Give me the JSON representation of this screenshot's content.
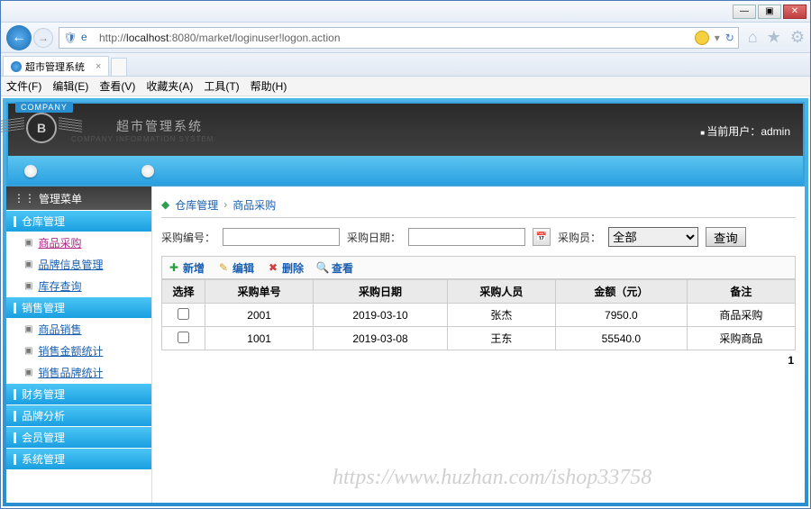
{
  "window": {
    "min": "—",
    "max": "▣",
    "close": "✕"
  },
  "browser": {
    "url_prefix": "http://",
    "url_host": "localhost",
    "url_rest": ":8080/market/loginuser!logon.action",
    "tab_title": "超市管理系统",
    "menu": [
      "文件(F)",
      "编辑(E)",
      "查看(V)",
      "收藏夹(A)",
      "工具(T)",
      "帮助(H)"
    ]
  },
  "app": {
    "company_tag": "COMPANY",
    "logo_letter": "B",
    "title": "超市管理系统",
    "subtitle": "COMPANY INFORMATION SYSTEM",
    "user_label": "当前用户：",
    "user_name": "admin"
  },
  "sidebar": {
    "title": "管理菜单",
    "groups": [
      {
        "label": "仓库管理",
        "items": [
          {
            "label": "商品采购",
            "active": true
          },
          {
            "label": "品牌信息管理"
          },
          {
            "label": "库存查询"
          }
        ]
      },
      {
        "label": "销售管理",
        "items": [
          {
            "label": "商品销售"
          },
          {
            "label": "销售金额统计"
          },
          {
            "label": "销售品牌统计"
          }
        ]
      },
      {
        "label": "财务管理",
        "items": []
      },
      {
        "label": "品牌分析",
        "items": []
      },
      {
        "label": "会员管理",
        "items": []
      },
      {
        "label": "系统管理",
        "items": []
      }
    ]
  },
  "breadcrumb": {
    "a": "仓库管理",
    "b": "商品采购"
  },
  "filter": {
    "code_label": "采购编号：",
    "date_label": "采购日期：",
    "buyer_label": "采购员：",
    "buyer_value": "全部",
    "search_btn": "查询"
  },
  "toolbar": {
    "add": "新增",
    "edit": "编辑",
    "del": "删除",
    "view": "查看"
  },
  "table": {
    "headers": [
      "选择",
      "采购单号",
      "采购日期",
      "采购人员",
      "金额（元）",
      "备注"
    ],
    "rows": [
      {
        "code": "2001",
        "date": "2019-03-10",
        "buyer": "张杰",
        "amount": "7950.0",
        "note": "商品采购"
      },
      {
        "code": "1001",
        "date": "2019-03-08",
        "buyer": "王东",
        "amount": "55540.0",
        "note": "采购商品"
      }
    ],
    "page": "1"
  },
  "watermark": "https://www.huzhan.com/ishop33758"
}
